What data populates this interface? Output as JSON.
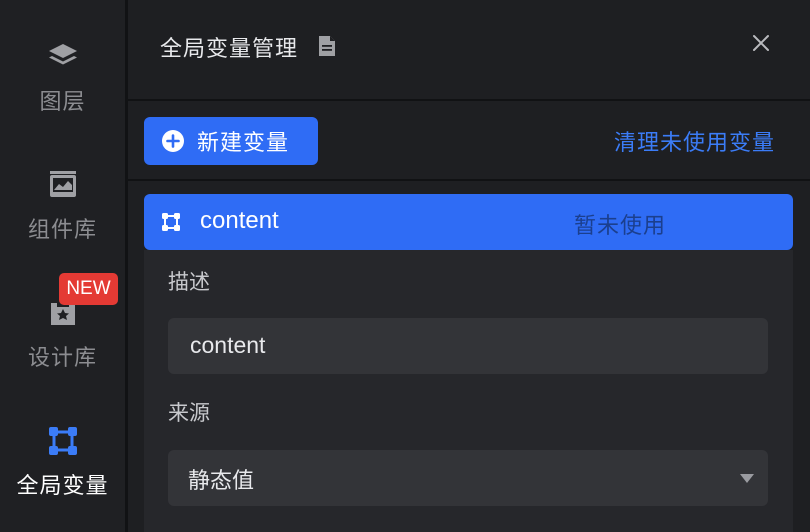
{
  "sidebar": {
    "items": [
      {
        "label": "图层",
        "icon": "layers-icon"
      },
      {
        "label": "组件库",
        "icon": "chart-image-icon"
      },
      {
        "label": "设计库",
        "icon": "design-library-icon"
      },
      {
        "label": "全局变量",
        "icon": "variable-icon"
      }
    ],
    "badge": "NEW",
    "active_index": 3
  },
  "panel": {
    "title": "全局变量管理",
    "new_button": "新建变量",
    "clean_link": "清理未使用变量"
  },
  "variables": [
    {
      "name": "content",
      "status": "暂未使用"
    }
  ],
  "detail": {
    "description_label": "描述",
    "description_value": "content",
    "source_label": "来源",
    "source_value": "静态值"
  },
  "colors": {
    "accent": "#2f6cf5",
    "link": "#3b7cf7",
    "badge": "#e43a34",
    "background": "#1e1f22"
  }
}
